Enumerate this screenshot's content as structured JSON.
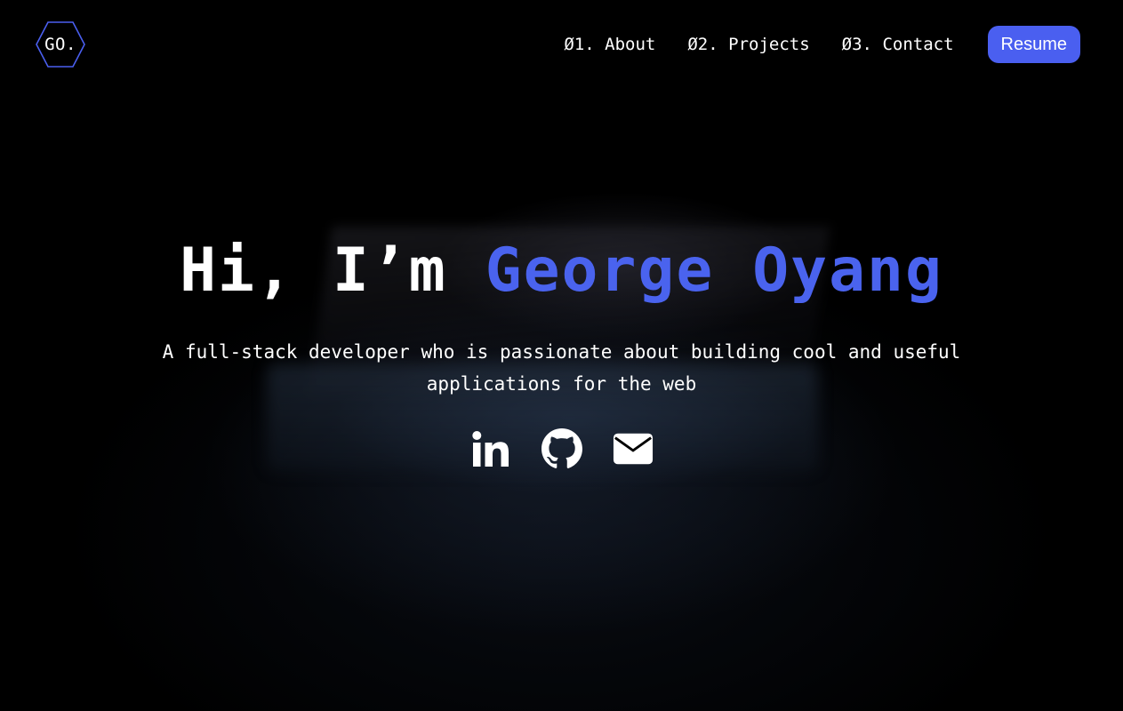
{
  "logo": {
    "text": "GO.",
    "hex_color": "#4a5ff0"
  },
  "nav": {
    "links": [
      {
        "number": "Ø1.",
        "label": "About"
      },
      {
        "number": "Ø2.",
        "label": "Projects"
      },
      {
        "number": "Ø3.",
        "label": "Contact"
      }
    ],
    "resume_label": "Resume"
  },
  "hero": {
    "greeting": "Hi, I’m",
    "name": "George Oyang",
    "subtitle": "A full-stack developer who is passionate about building cool and useful applications for the web"
  },
  "socials": [
    {
      "icon": "linkedin-icon"
    },
    {
      "icon": "github-icon"
    },
    {
      "icon": "email-icon"
    }
  ],
  "colors": {
    "accent": "#4a5ff0",
    "name": "#4a63ee",
    "background": "#000000",
    "text": "#ffffff"
  }
}
